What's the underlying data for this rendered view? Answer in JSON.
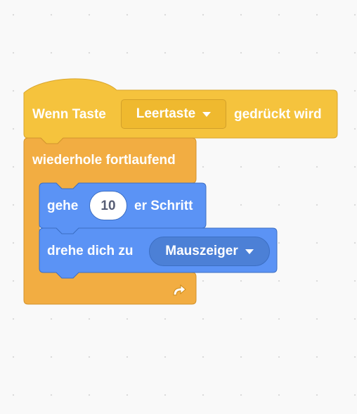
{
  "colors": {
    "events": "#f5c33d",
    "events_stroke": "#d9a62f",
    "control": "#f2ad42",
    "control_stroke": "#d3942e",
    "motion": "#5b93f5",
    "motion_stroke": "#3c6fc4",
    "workspace": "#f9f9f9"
  },
  "hat": {
    "label_prefix": "Wenn Taste",
    "key_value": "Leertaste",
    "label_suffix": "gedrückt wird"
  },
  "forever": {
    "label": "wiederhole fortlaufend",
    "loop_icon": "loop-arrow-icon"
  },
  "move": {
    "label_prefix": "gehe",
    "steps_value": "10",
    "label_suffix": "er Schritt"
  },
  "point": {
    "label_prefix": "drehe dich zu",
    "target_value": "Mauszeiger"
  }
}
